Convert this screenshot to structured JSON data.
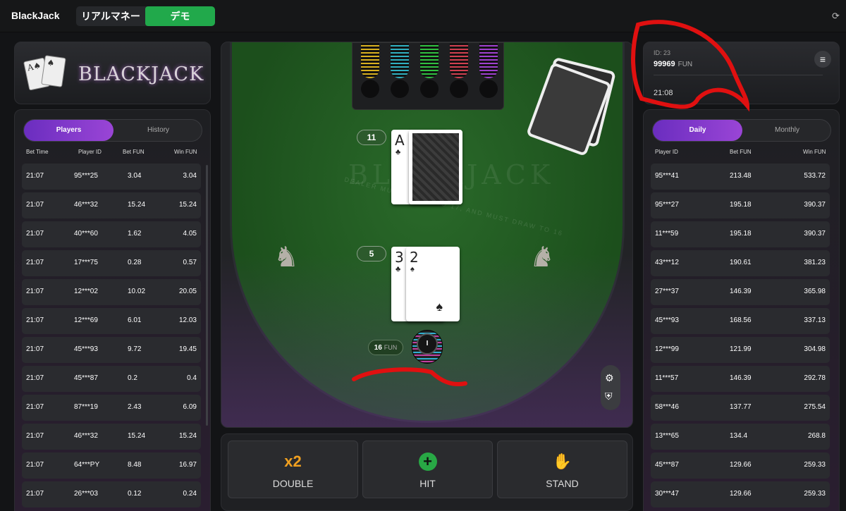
{
  "header": {
    "app_title": "BlackJack",
    "mode_real": "リアルマネー",
    "mode_demo": "デモ",
    "refresh_icon": "⟳"
  },
  "logo": {
    "text": "BLACKJACK",
    "card1": "A♠",
    "card2": "♠"
  },
  "players_panel": {
    "tabs": [
      "Players",
      "History"
    ],
    "active_tab": "Players",
    "columns": [
      "Bet Time",
      "Player ID",
      "Bet  FUN",
      "Win  FUN"
    ],
    "rows": [
      {
        "time": "21:07",
        "player": "95***25",
        "bet": "3.04",
        "win": "3.04"
      },
      {
        "time": "21:07",
        "player": "46***32",
        "bet": "15.24",
        "win": "15.24"
      },
      {
        "time": "21:07",
        "player": "40***60",
        "bet": "1.62",
        "win": "4.05"
      },
      {
        "time": "21:07",
        "player": "17***75",
        "bet": "0.28",
        "win": "0.57"
      },
      {
        "time": "21:07",
        "player": "12***02",
        "bet": "10.02",
        "win": "20.05"
      },
      {
        "time": "21:07",
        "player": "12***69",
        "bet": "6.01",
        "win": "12.03"
      },
      {
        "time": "21:07",
        "player": "45***93",
        "bet": "9.72",
        "win": "19.45"
      },
      {
        "time": "21:07",
        "player": "45***87",
        "bet": "0.2",
        "win": "0.4"
      },
      {
        "time": "21:07",
        "player": "87***19",
        "bet": "2.43",
        "win": "6.09"
      },
      {
        "time": "21:07",
        "player": "46***32",
        "bet": "15.24",
        "win": "15.24"
      },
      {
        "time": "21:07",
        "player": "64***PY",
        "bet": "8.48",
        "win": "16.97"
      },
      {
        "time": "21:07",
        "player": "26***03",
        "bet": "0.12",
        "win": "0.24"
      }
    ]
  },
  "table": {
    "felt_title": "BLACKJACK",
    "felt_subtitle": "DEALER MUST STAND TO 17, AND MUST DRAW TO 16",
    "dealer_score": "11",
    "dealer_card_rank": "A",
    "dealer_card_suit": "♣",
    "player_score": "5",
    "player_card1_rank": "3",
    "player_card1_suit": "♣",
    "player_card2_rank": "2",
    "player_card2_suit": "♠",
    "bet_amount": "16",
    "bet_currency": "FUN",
    "chip_label": "I",
    "chip_colors": [
      "#d8b020",
      "#30b0c0",
      "#30c040",
      "#d04050",
      "#a040d0"
    ],
    "settings_icon": "⚙",
    "shield_icon": "⛨"
  },
  "actions": {
    "double_icon": "x2",
    "double_label": "DOUBLE",
    "hit_icon": "+",
    "hit_label": "HIT",
    "stand_icon": "✋",
    "stand_label": "STAND"
  },
  "account": {
    "id": "ID: 23",
    "balance": "99969",
    "currency": "FUN",
    "time": "21:08",
    "menu_icon": "≡"
  },
  "leaderboard": {
    "tabs": [
      "Daily",
      "Monthly"
    ],
    "active_tab": "Daily",
    "columns": [
      "Player ID",
      "Bet  FUN",
      "Win  FUN"
    ],
    "rows": [
      {
        "player": "95***41",
        "bet": "213.48",
        "win": "533.72"
      },
      {
        "player": "95***27",
        "bet": "195.18",
        "win": "390.37"
      },
      {
        "player": "11***59",
        "bet": "195.18",
        "win": "390.37"
      },
      {
        "player": "43***12",
        "bet": "190.61",
        "win": "381.23"
      },
      {
        "player": "27***37",
        "bet": "146.39",
        "win": "365.98"
      },
      {
        "player": "45***93",
        "bet": "168.56",
        "win": "337.13"
      },
      {
        "player": "12***99",
        "bet": "121.99",
        "win": "304.98"
      },
      {
        "player": "11***57",
        "bet": "146.39",
        "win": "292.78"
      },
      {
        "player": "58***46",
        "bet": "137.77",
        "win": "275.54"
      },
      {
        "player": "13***65",
        "bet": "134.4",
        "win": "268.8"
      },
      {
        "player": "45***87",
        "bet": "129.66",
        "win": "259.33"
      },
      {
        "player": "30***47",
        "bet": "129.66",
        "win": "259.33"
      }
    ]
  },
  "colors": {
    "demo_green": "#21a94b",
    "tab_purple": "#8a3fd0",
    "felt_green": "#1f5a1f",
    "annotation_red": "#e01010",
    "double_orange": "#f0a020",
    "hit_green": "#28a845",
    "stand_red": "#e04020"
  }
}
